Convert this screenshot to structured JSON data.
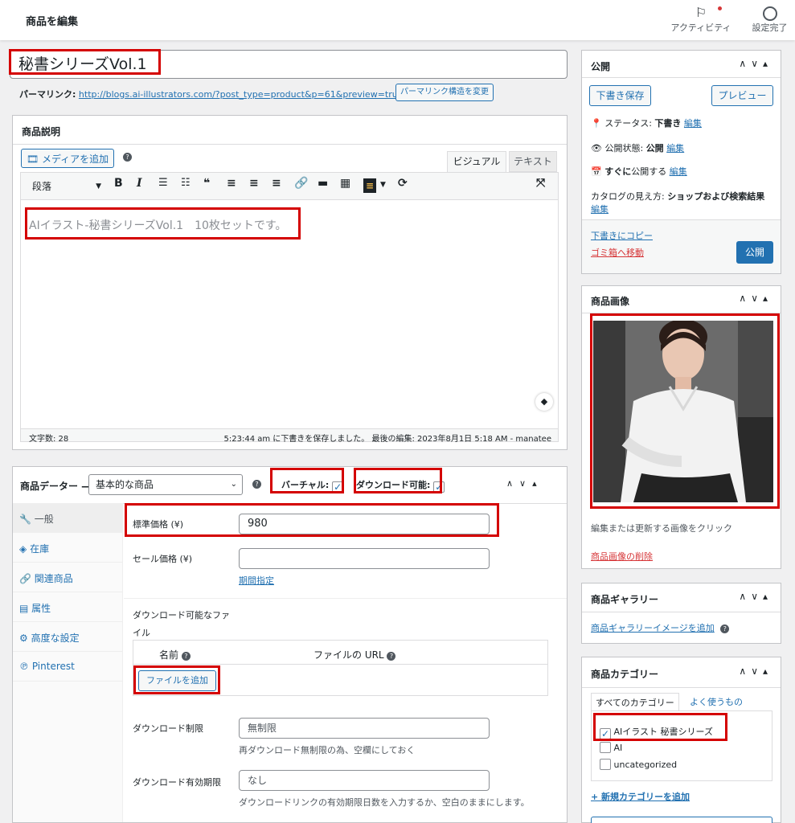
{
  "header": {
    "page_title": "商品を編集",
    "activity_label": "アクティビティ",
    "setup_label": "設定完了"
  },
  "post": {
    "title": "秘書シリーズVol.1",
    "permalink_label": "パーマリンク:",
    "permalink_url": "http://blogs.ai-illustrators.com/?post_type=product&p=61&preview=true",
    "permalink_button": "パーマリンク構造を変更"
  },
  "description": {
    "box_title": "商品説明",
    "add_media": "メディアを追加",
    "tab_visual": "ビジュアル",
    "tab_text": "テキスト",
    "format_select": "段落",
    "content": "AIイラスト-秘書シリーズVol.1　10枚セットです。",
    "word_count": "文字数: 28",
    "save_status": "5:23:44 am に下書きを保存しました。 最後の編集: 2023年8月1日 5:18 AM - manatee"
  },
  "product_data": {
    "label": "商品データー —",
    "type_select": "基本的な商品",
    "virtual_label": "バーチャル:",
    "downloadable_label": "ダウンロード可能:",
    "tabs": [
      {
        "label": "一般"
      },
      {
        "label": "在庫"
      },
      {
        "label": "関連商品"
      },
      {
        "label": "属性"
      },
      {
        "label": "高度な設定"
      },
      {
        "label": "Pinterest"
      }
    ],
    "regular_price_label": "標準価格 (¥)",
    "regular_price_value": "980",
    "sale_price_label": "セール価格 (¥)",
    "sale_price_value": "",
    "schedule_link": "期間指定",
    "downloadable_files_label_1": "ダウンロード可能なファ",
    "downloadable_files_label_2": "イル",
    "files_col_name": "名前",
    "files_col_url": "ファイルの URL",
    "add_file_button": "ファイルを追加",
    "download_limit_label": "ダウンロード制限",
    "download_limit_placeholder": "無制限",
    "download_limit_desc": "再ダウンロード無制限の為、空欄にしておく",
    "download_expiry_label": "ダウンロード有効期限",
    "download_expiry_placeholder": "なし",
    "download_expiry_desc": "ダウンロードリンクの有効期限日数を入力するか、空白のままにします。"
  },
  "publish": {
    "title": "公開",
    "save_draft": "下書き保存",
    "preview": "プレビュー",
    "status_label": "ステータス:",
    "status_value": "下書き",
    "visibility_label": "公開状態:",
    "visibility_value": "公開",
    "publish_time": "すぐに",
    "publish_time_suffix": "公開する",
    "edit_link": "編集",
    "catalog_label": "カタログの見え方:",
    "catalog_value": "ショップおよび検索結果",
    "copy_draft": "下書きにコピー",
    "trash": "ゴミ箱へ移動",
    "publish_button": "公開"
  },
  "product_image": {
    "title": "商品画像",
    "hint": "編集または更新する画像をクリック",
    "remove": "商品画像の削除"
  },
  "gallery": {
    "title": "商品ギャラリー",
    "add_link": "商品ギャラリーイメージを追加"
  },
  "categories": {
    "title": "商品カテゴリー",
    "tab_all": "すべてのカテゴリー",
    "tab_popular": "よく使うもの",
    "items": [
      {
        "label": "AIイラスト 秘書シリーズ",
        "checked": true
      },
      {
        "label": "AI",
        "checked": false
      },
      {
        "label": "uncategorized",
        "checked": false
      }
    ],
    "add_new": "+ 新規カテゴリーを追加"
  },
  "colors": {
    "accent": "#2271b1",
    "highlight": "#d40000",
    "danger": "#d63638"
  }
}
